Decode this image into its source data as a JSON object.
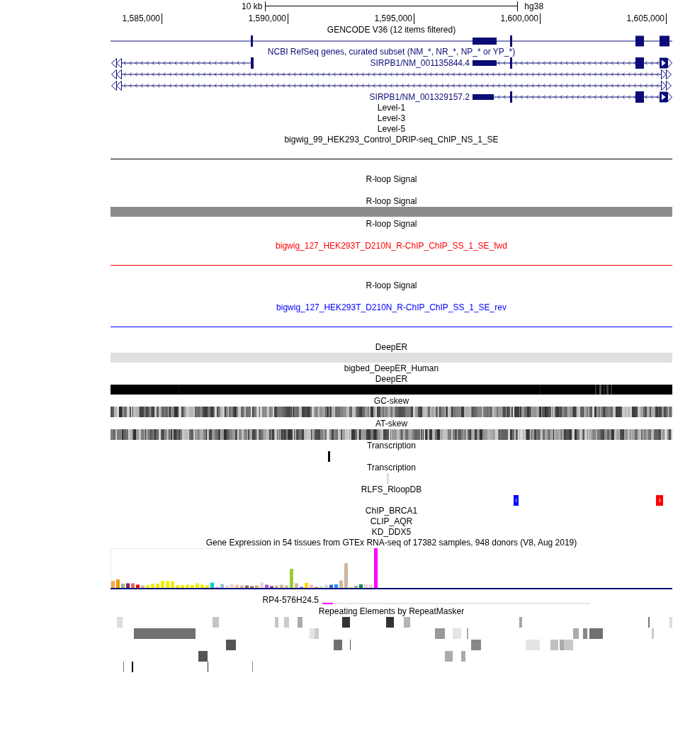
{
  "scale": {
    "label": "10 kb",
    "assembly": "hg38"
  },
  "ruler": {
    "ticks": [
      "1,585,000",
      "1,590,000",
      "1,595,000",
      "1,600,000",
      "1,605,000"
    ]
  },
  "tracks": [
    {
      "kind": "gencode",
      "title": "GENCODE V36 (12 items filtered)",
      "color": "#000000"
    },
    {
      "kind": "refseq",
      "title": "NCBI RefSeq genes, curated subset (NM_*, NR_*, NP_* or YP_*)",
      "color": "#0c0c78",
      "labels": [
        "SIRPB1/NM_001135844.4",
        "SIRPB1/NM_001329157.2"
      ]
    },
    {
      "kind": "label",
      "title": "Level-1",
      "color": "#000000"
    },
    {
      "kind": "label",
      "title": "Level-3",
      "color": "#000000"
    },
    {
      "kind": "label",
      "title": "Level-5",
      "color": "#000000"
    },
    {
      "kind": "signal-line",
      "title": "bigwig_99_HEK293_Control_DRIP-seq_ChIP_NS_1_SE",
      "color": "#000000"
    },
    {
      "kind": "empty",
      "title": "R-loop Signal",
      "color": "#000000"
    },
    {
      "kind": "signal-bar",
      "title": "R-loop Signal",
      "color": "#000000"
    },
    {
      "kind": "empty",
      "title": "R-loop Signal",
      "color": "#000000"
    },
    {
      "kind": "signal-line",
      "title": "bigwig_127_HEK293T_D210N_R-ChIP_ChIP_SS_1_SE_fwd",
      "color": "#ff0000"
    },
    {
      "kind": "empty",
      "title": "R-loop Signal",
      "color": "#000000"
    },
    {
      "kind": "signal-line",
      "title": "bigwig_127_HEK293T_D210N_R-ChIP_ChIP_SS_1_SE_rev",
      "color": "#0000ff"
    },
    {
      "kind": "light-bar",
      "title": "DeepER",
      "color": "#000000"
    },
    {
      "kind": "label",
      "title": "bigbed_DeepER_Human",
      "color": "#000000"
    },
    {
      "kind": "dark-strip",
      "title": "DeepER",
      "color": "#000000"
    },
    {
      "kind": "skew-strip",
      "title": "GC-skew",
      "color": "#000000"
    },
    {
      "kind": "skew-strip",
      "title": "AT-skew",
      "color": "#000000"
    },
    {
      "kind": "tick",
      "title": "Transcription",
      "color": "#000000"
    },
    {
      "kind": "tick",
      "title": "Transcription",
      "color": "#000000"
    },
    {
      "kind": "rlfs",
      "title": "RLFS_RloopDB",
      "color": "#000000"
    },
    {
      "kind": "label",
      "title": "ChIP_BRCA1",
      "color": "#000000"
    },
    {
      "kind": "label",
      "title": "CLIP_AQR",
      "color": "#000000"
    },
    {
      "kind": "label",
      "title": "KD_DDX5",
      "color": "#000000"
    },
    {
      "kind": "gtex",
      "title": "Gene Expression in 54 tissues from GTEx RNA-seq of 17382 samples, 948 donors (V8, Aug 2019)",
      "color": "#000000",
      "gene_label": "RP4-576H24.5"
    },
    {
      "kind": "repeats",
      "title": "Repeating Elements by RepeatMasker",
      "color": "#000000"
    }
  ]
}
